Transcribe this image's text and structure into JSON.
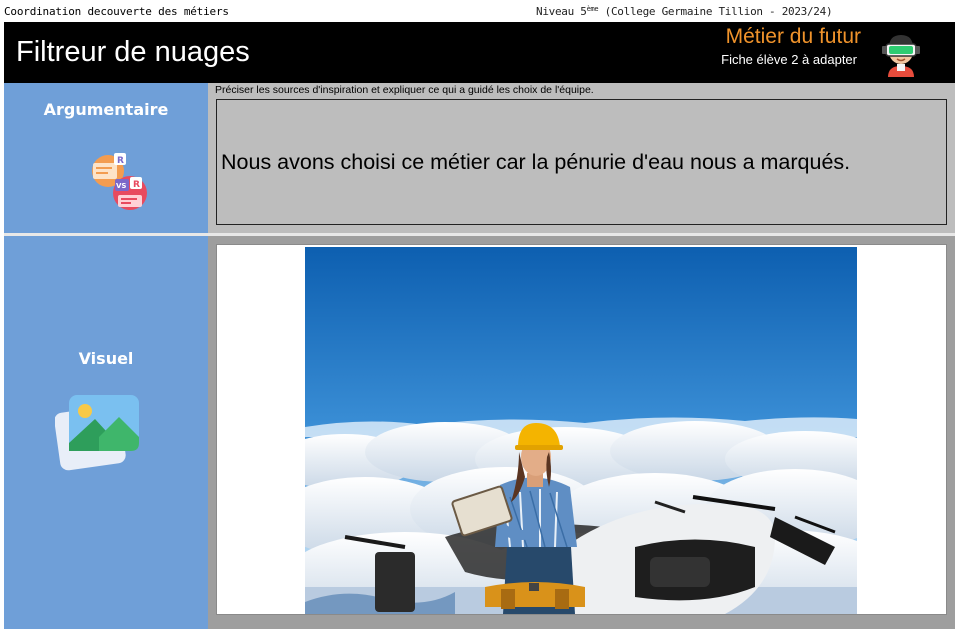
{
  "header": {
    "coordination": "Coordination decouverte des métiers",
    "niveau_prefix": "Niveau 5",
    "niveau_sup": "ème",
    "niveau_suffix": " (College Germaine Tillion - 2023/24)",
    "title": "Filtreur de nuages",
    "subtitle": "Métier du futur",
    "fiche": "Fiche élève 2 à adapter"
  },
  "sections": [
    {
      "label": "Argumentaire",
      "icon": "debate-icon"
    },
    {
      "label": "Visuel",
      "icon": "image-icon"
    }
  ],
  "argumentaire": {
    "hint": "Préciser les sources d'inspiration et expliquer ce qui a guidé les choix de l'équipe.",
    "text": "Nous avons choisi ce métier car la pénurie d'eau nous a marqués."
  },
  "colors": {
    "sidebar": "#6f9fd8",
    "banner": "#000000",
    "accent": "#f0932b",
    "panel": "#bdbdbd"
  }
}
